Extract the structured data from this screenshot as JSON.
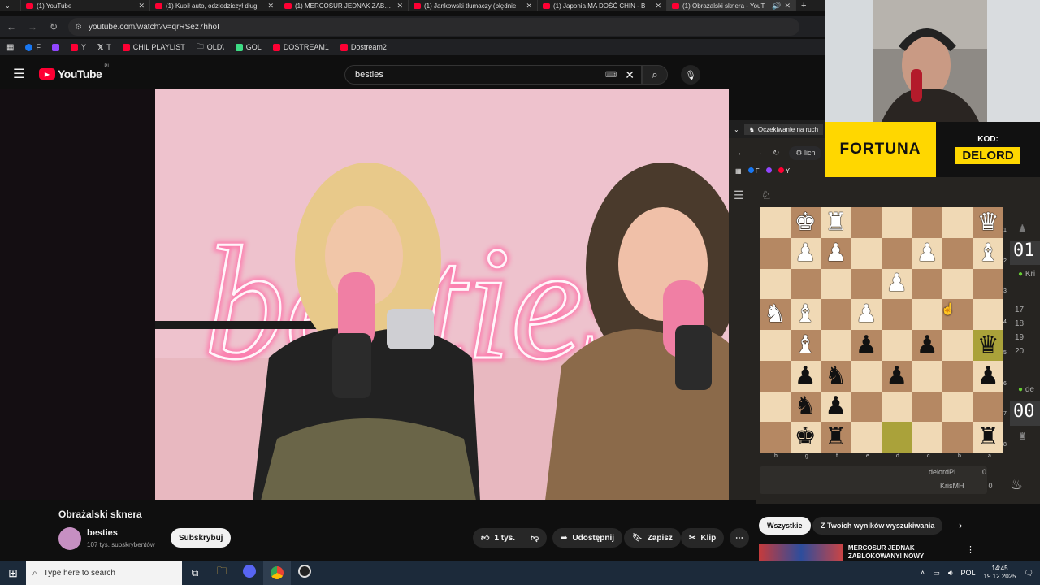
{
  "browser": {
    "tabs": [
      {
        "label": "(1) YouTube",
        "active": false
      },
      {
        "label": "(1) Kupił auto, odziedziczył dług",
        "active": false
      },
      {
        "label": "(1) MERCOSUR JEDNAK ZABLOK",
        "active": false
      },
      {
        "label": "(1) Jankowski tłumaczy (błędnie",
        "active": false
      },
      {
        "label": "(1) Japonia MA DOŚĆ CHIN - B",
        "active": false
      },
      {
        "label": "(1) Obrażalski sknera - YouT",
        "active": true
      }
    ],
    "url": "youtube.com/watch?v=qrRSez7hhoI",
    "bookmarks": [
      {
        "label": "F",
        "color": "#1877f2"
      },
      {
        "label": "",
        "color": "#9146ff"
      },
      {
        "label": "Y",
        "color": "#ff0033"
      },
      {
        "label": "T",
        "color": "#ffffff"
      },
      {
        "label": "CHIL PLAYLIST",
        "color": "#ff0033"
      },
      {
        "label": "OLD\\",
        "color": "#999999"
      },
      {
        "label": "GOL",
        "color": "#3ddc84"
      },
      {
        "label": "DOSTREAM1",
        "color": "#ff0033"
      },
      {
        "label": "Dostream2",
        "color": "#ff0033"
      }
    ]
  },
  "youtube": {
    "logo": "YouTube",
    "region": "PL",
    "search_value": "besties",
    "video": {
      "title": "Obrażalski sknera",
      "neon_text": "besties",
      "channel": "besties",
      "subscribers": "107 tys. subskrybentów",
      "subscribe_label": "Subskrybuj",
      "likes": "1 tys.",
      "share_label": "Udostępnij",
      "save_label": "Zapisz",
      "clip_label": "Klip"
    },
    "chips": [
      "Wszystkie",
      "Z Twoich wyników wyszukiwania"
    ],
    "recommendation_title": "MERCOSUR JEDNAK ZABLOKOWANY! NOWY"
  },
  "chess_window": {
    "tab_title": "Oczekiwanie na ruch",
    "url_fragment": "lich",
    "bookmarks": [
      "F",
      "Y"
    ],
    "files": [
      "h",
      "g",
      "f",
      "e",
      "d",
      "c",
      "b",
      "a"
    ],
    "ranks": [
      "1",
      "2",
      "3",
      "4",
      "5",
      "6",
      "7",
      "8"
    ],
    "board": [
      [
        "",
        "wK",
        "wR",
        "",
        "",
        "",
        "",
        "wQ"
      ],
      [
        "",
        "wP",
        "wP",
        "",
        "",
        "wP",
        "",
        "wB"
      ],
      [
        "",
        "",
        "",
        "",
        "wP",
        "",
        "",
        ""
      ],
      [
        "wN",
        "wB",
        "",
        "wP",
        "",
        "",
        "",
        ""
      ],
      [
        "",
        "wB",
        "",
        "bP",
        "",
        "bP",
        "",
        "bQ"
      ],
      [
        "",
        "bP",
        "bN",
        "",
        "bP",
        "",
        "",
        "bP"
      ],
      [
        "",
        "bN",
        "bP",
        "",
        "",
        "",
        "",
        ""
      ],
      [
        "",
        "bK",
        "bR",
        "",
        "",
        "",
        "",
        "bR"
      ]
    ],
    "highlight_squares": [
      "4,7",
      "7,4"
    ],
    "clock_top": "01",
    "clock_bottom": "00",
    "player_top": "Kri",
    "player_bottom": "de",
    "move_numbers": [
      "17",
      "18",
      "19",
      "20"
    ],
    "scores": [
      {
        "name": "delordPL",
        "score": "0"
      },
      {
        "name": "KrisMH",
        "score": "0"
      }
    ]
  },
  "sponsor": {
    "brand": "FORTUNA",
    "code_label": "KOD:",
    "code": "DELORD",
    "brand_color": "#ffd700"
  },
  "taskbar": {
    "search_placeholder": "Type here to search",
    "language": "POL",
    "time": "14:45",
    "date": "19.12.2025"
  }
}
